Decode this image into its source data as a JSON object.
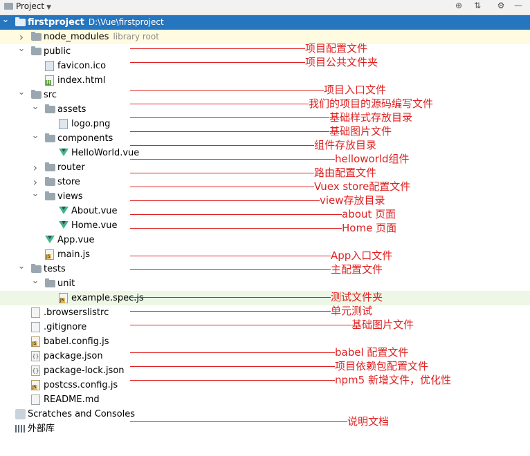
{
  "toolbar": {
    "project_label": "Project",
    "icons": [
      "target-icon",
      "collapse-icon",
      "gear-icon",
      "minimize-icon"
    ]
  },
  "tree": [
    {
      "label": "firstproject",
      "path": "D:\\Vue\\firstproject",
      "icon": "folder",
      "arrow": "down",
      "indent": 0,
      "selected": true
    },
    {
      "label": "node_modules",
      "suffix": "library root",
      "icon": "folder",
      "arrow": "right",
      "indent": 1,
      "lib": true
    },
    {
      "label": "public",
      "icon": "folder",
      "arrow": "down",
      "indent": 1
    },
    {
      "label": "favicon.ico",
      "icon": "img",
      "indent": 2
    },
    {
      "label": "index.html",
      "icon": "html",
      "indent": 2
    },
    {
      "label": "src",
      "icon": "folder",
      "arrow": "down",
      "indent": 1
    },
    {
      "label": "assets",
      "icon": "folder",
      "arrow": "down",
      "indent": 2
    },
    {
      "label": "logo.png",
      "icon": "img",
      "indent": 3
    },
    {
      "label": "components",
      "icon": "folder",
      "arrow": "down",
      "indent": 2
    },
    {
      "label": "HelloWorld.vue",
      "icon": "vue",
      "indent": 3
    },
    {
      "label": "router",
      "icon": "folder",
      "arrow": "right",
      "indent": 2
    },
    {
      "label": "store",
      "icon": "folder",
      "arrow": "right",
      "indent": 2
    },
    {
      "label": "views",
      "icon": "folder",
      "arrow": "down",
      "indent": 2
    },
    {
      "label": "About.vue",
      "icon": "vue",
      "indent": 3
    },
    {
      "label": "Home.vue",
      "icon": "vue",
      "indent": 3
    },
    {
      "label": "App.vue",
      "icon": "vue",
      "indent": 2
    },
    {
      "label": "main.js",
      "icon": "js",
      "indent": 2
    },
    {
      "label": "tests",
      "icon": "folder",
      "arrow": "down",
      "indent": 1
    },
    {
      "label": "unit",
      "icon": "folder",
      "arrow": "down",
      "indent": 2
    },
    {
      "label": "example.spec.js",
      "icon": "js",
      "indent": 3,
      "highlight": true
    },
    {
      "label": ".browserslistrc",
      "icon": "file",
      "indent": 1
    },
    {
      "label": ".gitignore",
      "icon": "file",
      "indent": 1
    },
    {
      "label": "babel.config.js",
      "icon": "js",
      "indent": 1
    },
    {
      "label": "package.json",
      "icon": "json",
      "indent": 1
    },
    {
      "label": "package-lock.json",
      "icon": "json",
      "indent": 1
    },
    {
      "label": "postcss.config.js",
      "icon": "js",
      "indent": 1
    },
    {
      "label": "README.md",
      "icon": "file",
      "indent": 1
    },
    {
      "label": "Scratches and Consoles",
      "icon": "scratch",
      "indent": -1
    },
    {
      "label": "外部库",
      "icon": "lib",
      "indent": -1
    }
  ],
  "annotations": [
    {
      "text": "项目配置文件"
    },
    {
      "text": "项目公共文件夹"
    },
    {
      "text": "项目入口文件"
    },
    {
      "text": "我们的项目的源码编写文件"
    },
    {
      "text": "基础样式存放目录"
    },
    {
      "text": "基础图片文件"
    },
    {
      "text": "组件存放目录"
    },
    {
      "text": "helloworld组件"
    },
    {
      "text": "路由配置文件"
    },
    {
      "text": "Vuex store配置文件"
    },
    {
      "text": "view存放目录"
    },
    {
      "text": "about 页面"
    },
    {
      "text": "Home 页面"
    },
    {
      "text": "App入口文件"
    },
    {
      "text": "主配置文件"
    },
    {
      "text": "测试文件夹"
    },
    {
      "text": "单元测试"
    },
    {
      "text": "基础图片文件"
    },
    {
      "text": "babel 配置文件"
    },
    {
      "text": "项目依赖包配置文件"
    },
    {
      "text": "npm5 新增文件，优化性"
    },
    {
      "text": "说明文档"
    }
  ],
  "colors": {
    "selection": "#2675bf",
    "annotation": "#e02020",
    "vue": "#41b883"
  }
}
